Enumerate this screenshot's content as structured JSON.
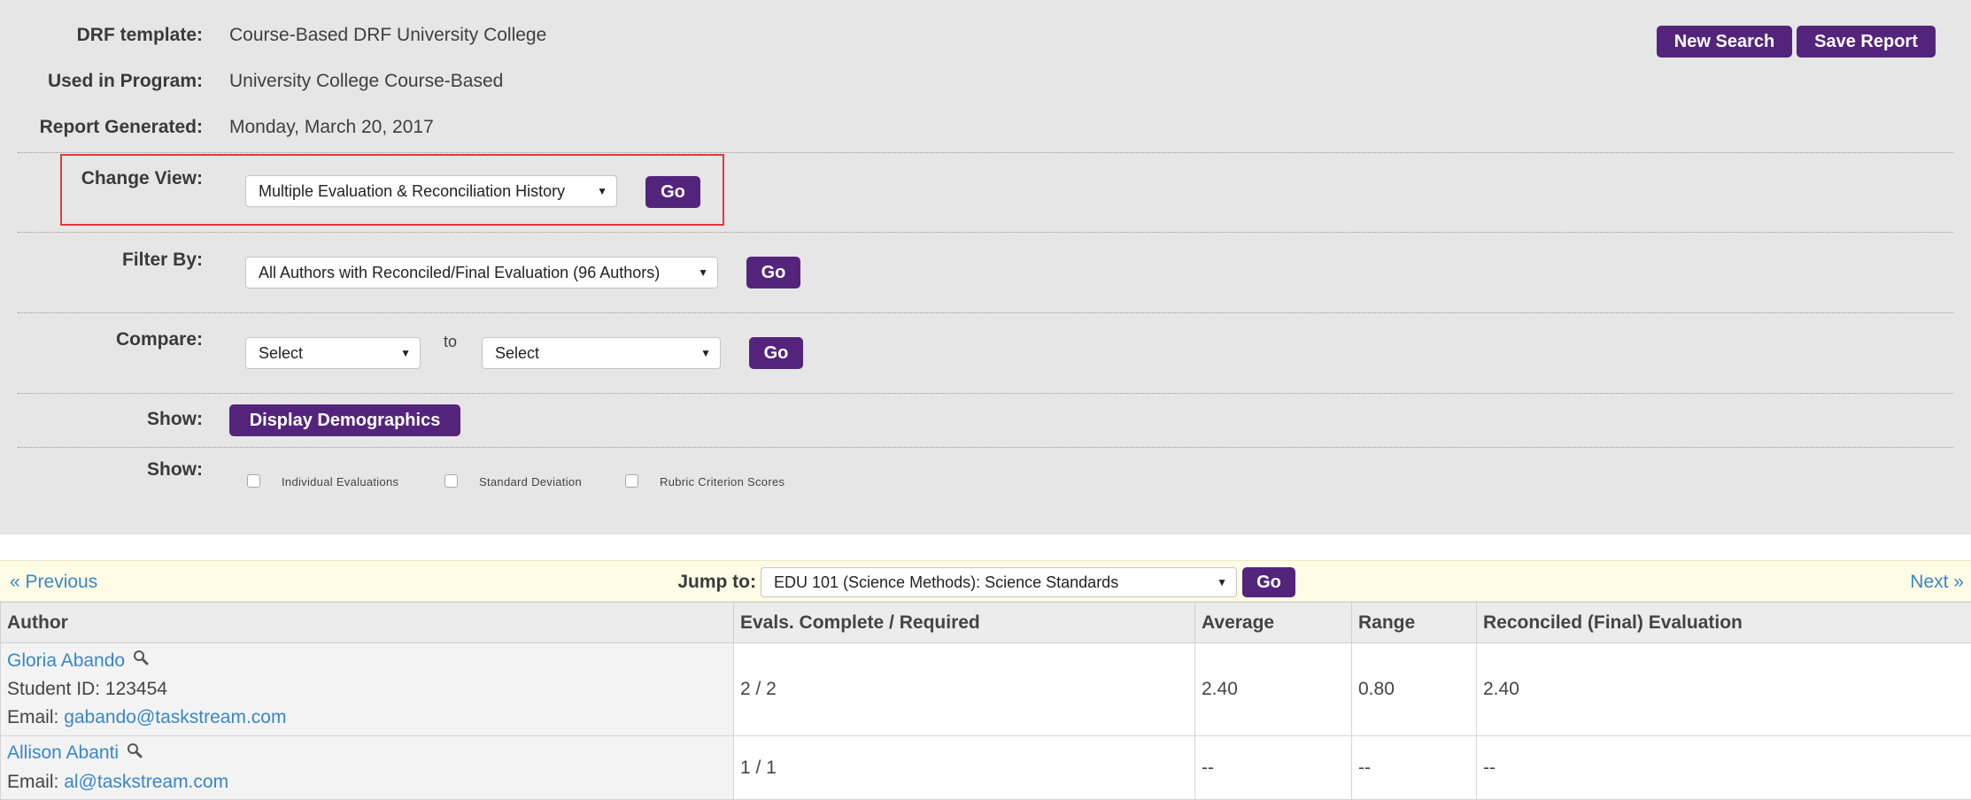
{
  "header": {
    "drf_template": {
      "label": "DRF template:",
      "value": "Course-Based DRF University College"
    },
    "used_in_program": {
      "label": "Used in Program:",
      "value": "University College Course-Based"
    },
    "report_generated": {
      "label": "Report Generated:",
      "value": "Monday, March 20, 2017"
    },
    "new_search_label": "New Search",
    "save_report_label": "Save Report"
  },
  "change_view": {
    "label": "Change View:",
    "selected": "Multiple Evaluation & Reconciliation History",
    "go_label": "Go"
  },
  "filter_by": {
    "label": "Filter By:",
    "selected": "All Authors with Reconciled/Final Evaluation (96 Authors)",
    "go_label": "Go"
  },
  "compare": {
    "label": "Compare:",
    "left_selected": "Select",
    "to_label": "to",
    "right_selected": "Select",
    "go_label": "Go"
  },
  "show_demographics": {
    "label": "Show:",
    "button_label": "Display Demographics"
  },
  "show_options": {
    "label": "Show:",
    "options": [
      {
        "label": "Individual Evaluations",
        "checked": false
      },
      {
        "label": "Standard Deviation",
        "checked": false
      },
      {
        "label": "Rubric Criterion Scores",
        "checked": false
      }
    ]
  },
  "navigation": {
    "previous_label": "« Previous",
    "jump_label": "Jump to:",
    "jump_selected": "EDU 101 (Science Methods): Science Standards",
    "go_label": "Go",
    "next_label": "Next »"
  },
  "table": {
    "headers": [
      "Author",
      "Evals. Complete / Required",
      "Average",
      "Range",
      "Reconciled (Final) Evaluation"
    ],
    "rows": [
      {
        "name": "Gloria Abando",
        "student_id": "Student ID: 123454",
        "email_label": "Email:",
        "email": "gabando@taskstream.com",
        "evals": "2 / 2",
        "average": "2.40",
        "range": "0.80",
        "reconciled": "2.40"
      },
      {
        "name": "Allison Abanti",
        "email_label": "Email:",
        "email": "al@taskstream.com",
        "evals": "1 / 1",
        "average": "--",
        "range": "--",
        "reconciled": "--"
      }
    ]
  },
  "colors": {
    "button_purple": "#54247d",
    "link_blue": "#3a86c8",
    "highlight_red": "#e03a3a",
    "nav_bar_bg": "#fefce5",
    "panel_bg": "#e6e6e6"
  },
  "icons": [
    "magnifier-icon",
    "dropdown-arrow-icon"
  ]
}
